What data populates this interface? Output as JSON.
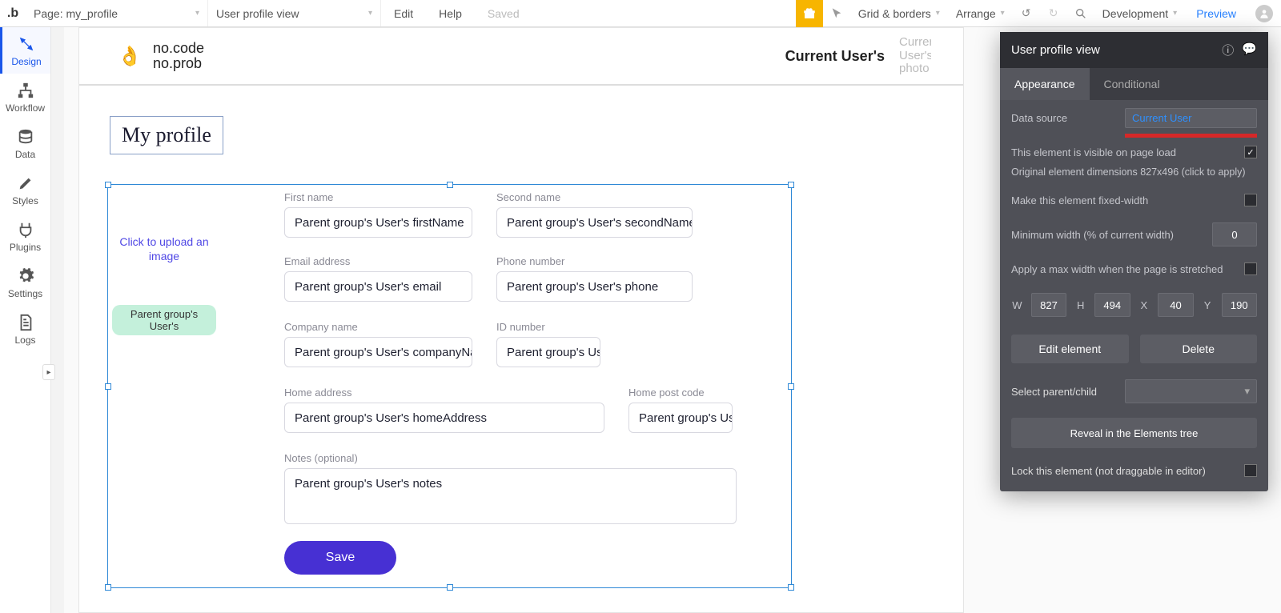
{
  "topbar": {
    "page_label": "Page: my_profile",
    "element_label": "User profile view",
    "edit": "Edit",
    "help": "Help",
    "saved": "Saved",
    "grid": "Grid & borders",
    "arrange": "Arrange",
    "env": "Development",
    "preview": "Preview"
  },
  "rail": {
    "design": "Design",
    "workflow": "Workflow",
    "data": "Data",
    "styles": "Styles",
    "plugins": "Plugins",
    "settings": "Settings",
    "logs": "Logs"
  },
  "page": {
    "brand_l1": "no.code",
    "brand_l2": "no.prob",
    "current_user": "Current User's",
    "photo_label": "Current User's photo",
    "title": "My profile",
    "uploader": "Click to upload an image",
    "status_pill": "Parent group's User's",
    "labels": {
      "first": "First name",
      "second": "Second name",
      "email": "Email address",
      "phone": "Phone number",
      "company": "Company name",
      "id": "ID number",
      "home": "Home address",
      "post": "Home post code",
      "notes": "Notes (optional)"
    },
    "values": {
      "first": "Parent group's User's firstName",
      "second": "Parent group's User's secondName",
      "email": "Parent group's User's email",
      "phone": "Parent group's User's phone",
      "company": "Parent group's User's companyNa",
      "id": "Parent group's Us",
      "home": "Parent group's User's homeAddress",
      "post": "Parent group's Us",
      "notes": "Parent group's User's notes"
    },
    "save": "Save"
  },
  "panel": {
    "title": "User profile view",
    "tabs": {
      "appearance": "Appearance",
      "conditional": "Conditional"
    },
    "data_source_label": "Data source",
    "data_source_value": "Current User",
    "visible_label": "This element is visible on page load",
    "orig_dims": "Original element dimensions 827x496 (click to apply)",
    "fixed_width": "Make this element fixed-width",
    "min_width_label": "Minimum width (% of current width)",
    "min_width_value": "0",
    "max_width": "Apply a max width when the page is stretched",
    "dims": {
      "W": "827",
      "H": "494",
      "X": "40",
      "Y": "190"
    },
    "edit_el": "Edit element",
    "delete": "Delete",
    "select_parent": "Select parent/child",
    "reveal": "Reveal in the Elements tree",
    "lock": "Lock this element (not draggable in editor)"
  }
}
